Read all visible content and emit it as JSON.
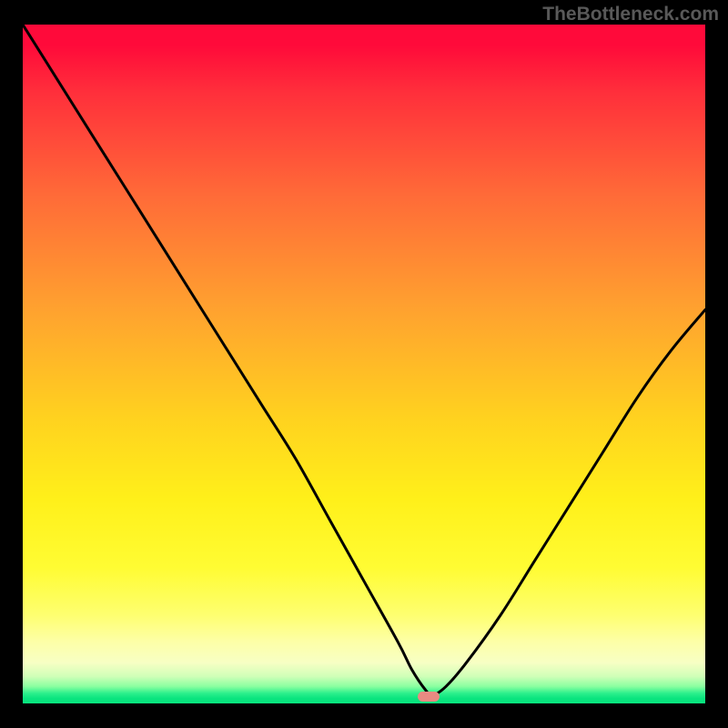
{
  "attribution": "TheBottleneck.com",
  "colors": {
    "page_bg": "#000000",
    "attribution_text": "#595959",
    "curve_stroke": "#000000",
    "marker_fill": "#e88a82",
    "gradient_top": "#ff0a3a",
    "gradient_mid": "#fff01a",
    "gradient_bottom": "#09e47e"
  },
  "chart_data": {
    "type": "line",
    "title": "",
    "xlabel": "",
    "ylabel": "",
    "xlim": [
      0,
      100
    ],
    "ylim": [
      0,
      100
    ],
    "grid": false,
    "legend": false,
    "series": [
      {
        "name": "bottleneck-curve",
        "x": [
          0,
          5,
          10,
          15,
          20,
          25,
          30,
          35,
          40,
          45,
          50,
          55,
          57,
          59,
          60,
          62,
          65,
          70,
          75,
          80,
          85,
          90,
          95,
          100
        ],
        "values": [
          100,
          92,
          84,
          76,
          68,
          60,
          52,
          44,
          36,
          27,
          18,
          9,
          5,
          2,
          1.2,
          2.5,
          6,
          13,
          21,
          29,
          37,
          45,
          52,
          58
        ]
      }
    ],
    "marker": {
      "x": 59.5,
      "y": 1.0,
      "width": 3.2,
      "height": 1.6
    },
    "notes": "x and y are in percent of plot area; values are approximate readings from the rendered curve. Minimum (optimal point) ≈ x=60."
  }
}
